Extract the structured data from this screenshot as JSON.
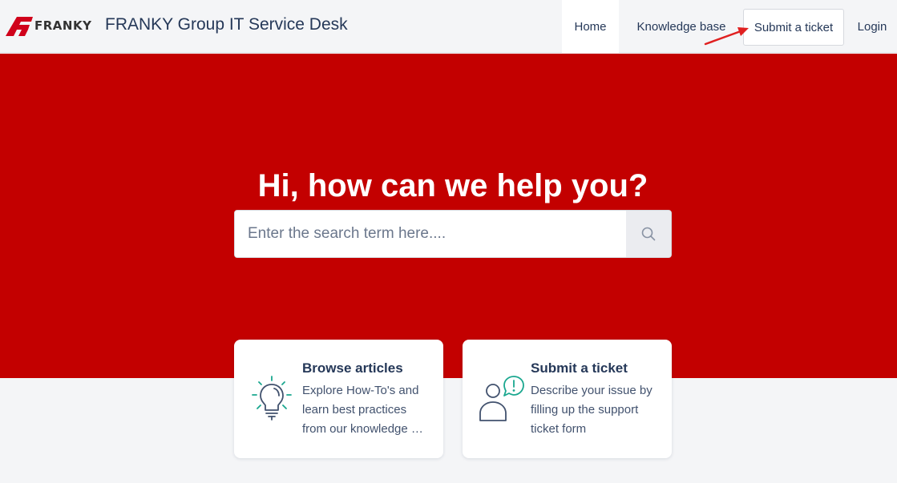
{
  "header": {
    "logo_text": "FRANKY",
    "site_title": "FRANKY Group IT Service Desk",
    "nav": {
      "home": "Home",
      "knowledge_base": "Knowledge base",
      "submit_ticket": "Submit a ticket",
      "login": "Login"
    }
  },
  "hero": {
    "title": "Hi, how can we help you?",
    "search": {
      "placeholder": "Enter the search term here....",
      "value": "",
      "button_icon": "search-icon"
    }
  },
  "cards": [
    {
      "title": "Browse articles",
      "desc_lines": [
        "Explore How-To's and",
        "learn best practices",
        "from our knowledge base"
      ],
      "icon": "lightbulb-icon"
    },
    {
      "title": "Submit a ticket",
      "desc_lines": [
        "Describe your issue by",
        "filling up the support",
        "ticket form"
      ],
      "icon": "user-alert-icon"
    }
  ],
  "colors": {
    "brand_red": "#c30000",
    "accent_green": "#1aa78f",
    "text_dark": "#253858",
    "annotation_arrow": "#e02020"
  }
}
